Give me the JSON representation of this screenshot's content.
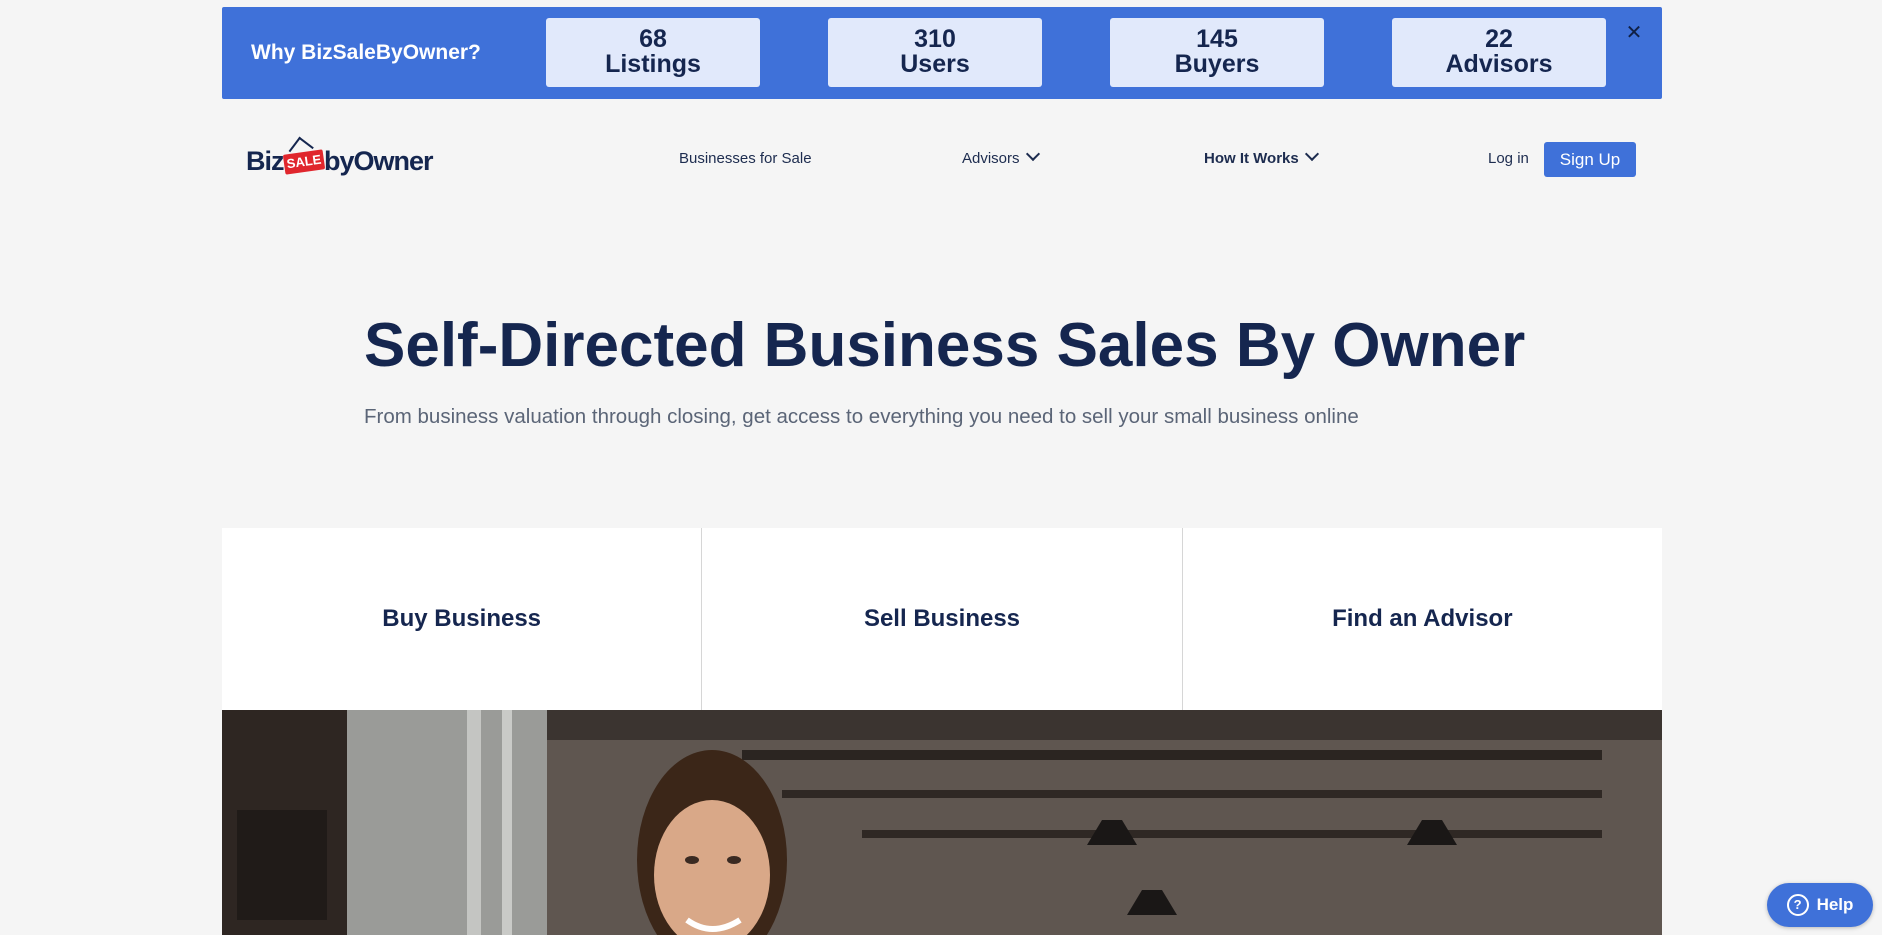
{
  "promo": {
    "title": "Why BizSaleByOwner?",
    "stats": [
      {
        "value": "68",
        "label": "Listings"
      },
      {
        "value": "310",
        "label": "Users"
      },
      {
        "value": "145",
        "label": "Buyers"
      },
      {
        "value": "22",
        "label": "Advisors"
      }
    ],
    "close_glyph": "✕"
  },
  "logo": {
    "part1": "Biz",
    "tag": "SALE",
    "part2": "byOwner"
  },
  "nav": {
    "businesses": "Businesses for Sale",
    "advisors": "Advisors",
    "how_it_works": "How It Works",
    "login": "Log in",
    "signup": "Sign Up"
  },
  "hero": {
    "title": "Self-Directed Business Sales By Owner",
    "subtitle": "From business valuation through closing, get access to everything you need to sell your small business online"
  },
  "cards": [
    {
      "label": "Buy Business"
    },
    {
      "label": "Sell Business"
    },
    {
      "label": "Find an Advisor"
    }
  ],
  "help": {
    "label": "Help",
    "icon_glyph": "?"
  },
  "colors": {
    "brand_blue": "#3f71d9",
    "navy": "#15264f",
    "sale_red": "#e0262d"
  }
}
